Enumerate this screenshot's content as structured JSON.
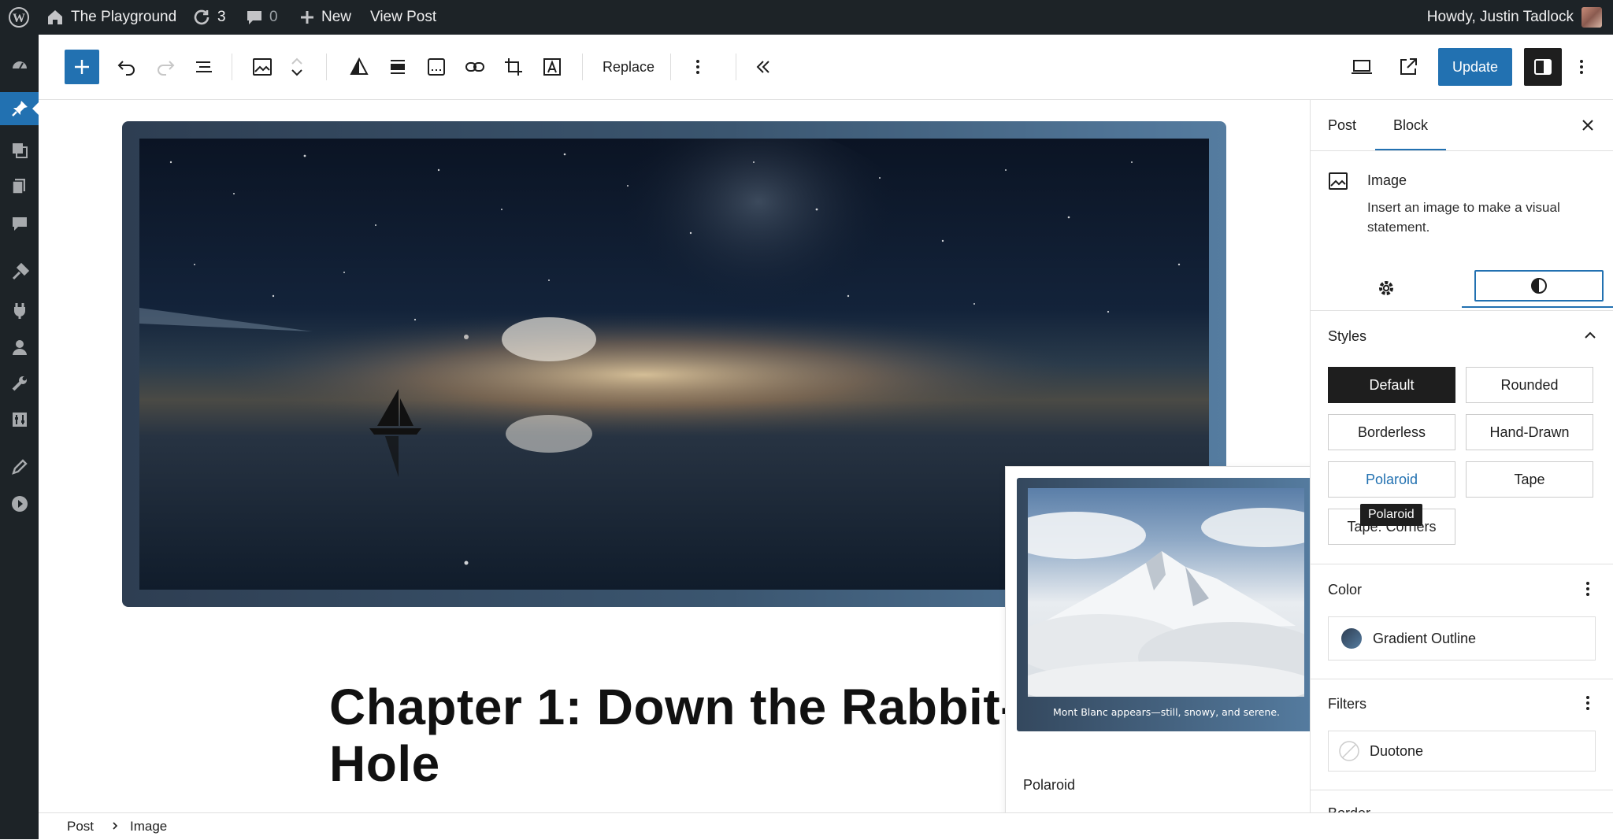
{
  "admin_bar": {
    "site_name": "The Playground",
    "updates_count": "3",
    "comments_count": "0",
    "new_label": "New",
    "view_post_label": "View Post",
    "greeting": "Howdy, Justin Tadlock"
  },
  "toolbar": {
    "replace_label": "Replace",
    "update_label": "Update",
    "accent_color": "#2271b1"
  },
  "canvas": {
    "heading": "Chapter 1: Down the Rabbit-Hole"
  },
  "style_preview": {
    "caption": "Mont Blanc appears—still, snowy, and serene.",
    "label": "Polaroid"
  },
  "sidebar": {
    "tabs": [
      "Post",
      "Block"
    ],
    "active_tab": "Block",
    "block": {
      "title": "Image",
      "description": "Insert an image to make a visual statement."
    },
    "styles": {
      "title": "Styles",
      "options": [
        "Default",
        "Rounded",
        "Borderless",
        "Hand-Drawn",
        "Polaroid",
        "Tape",
        "Tape: Corners"
      ],
      "selected": "Default",
      "hovered": "Polaroid",
      "tooltip": "Polaroid"
    },
    "color": {
      "title": "Color",
      "item": "Gradient Outline"
    },
    "filters": {
      "title": "Filters",
      "item": "Duotone"
    },
    "next_panel_partial": "Border"
  },
  "breadcrumb": [
    "Post",
    "Image"
  ]
}
